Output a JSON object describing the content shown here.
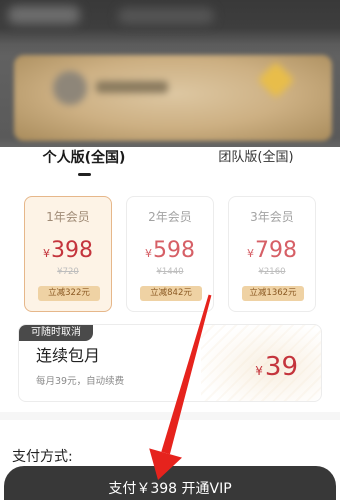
{
  "tabs": [
    {
      "label": "个人版(全国)",
      "selected": true
    },
    {
      "label": "团队版(全国)",
      "selected": false
    }
  ],
  "plans": [
    {
      "title": "1年会员",
      "currency": "¥",
      "price": "398",
      "original_price": "¥720",
      "discount": "立减322元",
      "selected": true
    },
    {
      "title": "2年会员",
      "currency": "¥",
      "price": "598",
      "original_price": "¥1440",
      "discount": "立减842元",
      "selected": false
    },
    {
      "title": "3年会员",
      "currency": "¥",
      "price": "798",
      "original_price": "¥2160",
      "discount": "立减1362元",
      "selected": false
    }
  ],
  "subscription": {
    "tag": "可随时取消",
    "title": "连续包月",
    "description": "每月39元，自动续费",
    "currency": "¥",
    "price": "39"
  },
  "payment_method": {
    "label": "支付方式:"
  },
  "pay_button": {
    "label": "支付￥398 开通VIP"
  },
  "colors": {
    "price_red": "#c4343c",
    "price_red_light": "#d65f66",
    "selected_card_bg": "#fdf3e6",
    "selected_card_border": "#e6b78a",
    "badge_bg": "#efd2a4",
    "badge_text": "#8b5a24",
    "tag_bg": "#4a4a4a",
    "button_bg": "#383838",
    "annotation_arrow": "#e6231d"
  }
}
